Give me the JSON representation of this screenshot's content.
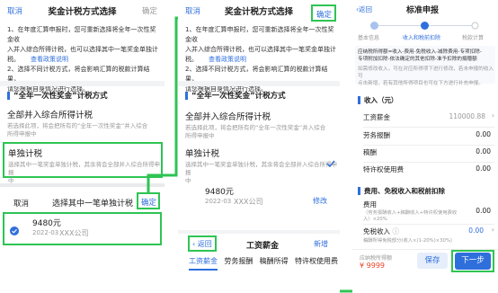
{
  "panel1": {
    "header": {
      "cancel": "取消",
      "title": "奖金计税方式选择",
      "confirm": "确定"
    },
    "notice": {
      "line1": "1、在年度汇算申报时，您可重新选择将全年一次性奖金收",
      "line2": "入并入综合所得计税，也可以选择其中一笔奖金单独计",
      "line3": "税。",
      "link": "查看政策说明",
      "line4": "2、选择不同计税方式，将会影响汇算的税款计算结果，",
      "line5": "请您根据自身情况进行选择。"
    },
    "section_title": "“全年一次性奖金”计税方式",
    "option_all": {
      "title": "全部并入综合所得计税",
      "desc1": "若选择此项，将会把所有的“全年一次性奖金”并入综合",
      "desc2": "所得申报中"
    },
    "option_single": {
      "title": "单独计税",
      "desc1": "选择其中一笔奖金单独计税，其余将会全部并入综合所得申报",
      "desc2": "中"
    },
    "sub_header": {
      "cancel": "取消",
      "title": "选择其中一笔单独计税",
      "confirm": "确定"
    },
    "bonus_item": {
      "amount": "9480元",
      "date": "2022-03",
      "company": "XXX公司"
    }
  },
  "panel2": {
    "header": {
      "cancel": "取消",
      "title": "奖金计税方式选择",
      "confirm": "确定"
    },
    "notice": {
      "line1": "1、在年度汇算申报时，您可重新选择将全年一次性奖金收",
      "line2": "入并入综合所得计税，也可以选择其中一笔奖金单独计",
      "line3": "税。",
      "link": "查看政策说明",
      "line4": "2、选择不同计税方式，将会影响汇算的税款计算结果，",
      "line5": "请您根据自身情况进行选择。"
    },
    "section_title": "“全年一次性奖金”计税方式",
    "option_all": {
      "title": "全部并入综合所得计税",
      "desc1": "若选择此项，将会把所有的“全年一次性奖金”并入综合",
      "desc2": "所得申报中"
    },
    "option_single": {
      "title": "单独计税",
      "desc1": "选择其中一笔奖金单独计税，其余将会全部并入综合所得申报",
      "desc2": "中"
    },
    "bonus_item": {
      "amount": "9480元",
      "date": "2022-03",
      "company": "XXX公司",
      "modify": "修改"
    },
    "salary_header": {
      "back": "返回",
      "title": "工资薪金",
      "add": "新增"
    },
    "tabs": [
      "工资薪金",
      "劳务报酬",
      "稿酬所得",
      "特许权使用费"
    ]
  },
  "panel3": {
    "header": {
      "back": "返回",
      "title": "标准申报"
    },
    "steps": [
      "基本信息",
      "收入和税前扣除",
      "税款计算"
    ],
    "formula": {
      "line1": "应纳税所得额=收入-费用-免税收入-减除费用-专项扣除-",
      "line2": "专项附加扣除-依法确定的其他扣除-准予扣除的捐赠额",
      "line3": "如需修改收入，可在对应所得项下进行修改，若未申报的收入可",
      "line4": "点击新增，若有其他所得项目也可在下方进行补充申报。"
    },
    "income_section": "收入（元）",
    "income_rows": [
      {
        "label": "工资薪金",
        "value": "110000.88",
        "chevron": true
      },
      {
        "label": "劳务报酬",
        "value": "0.00",
        "chevron": false
      },
      {
        "label": "稿酬",
        "value": "0.00",
        "chevron": false
      },
      {
        "label": "特许权使用费",
        "value": "0.00",
        "chevron": false
      }
    ],
    "deduction_section": "费用、免税收入和税前扣除",
    "fee": {
      "label": "费用",
      "desc1": "（劳务报酬收入+稿酬收入+特许权使用费收",
      "desc2": "入）×20%",
      "value": "0.00"
    },
    "tax_free": {
      "label": "免税收入",
      "value": "0.00"
    },
    "tax_free_desc": "稿酬所得免税部分(收入×(1-20%)×30%)",
    "footer": {
      "label": "应纳税所得额",
      "amount": "¥ 9999",
      "save": "保存",
      "next": "下一步"
    }
  }
}
